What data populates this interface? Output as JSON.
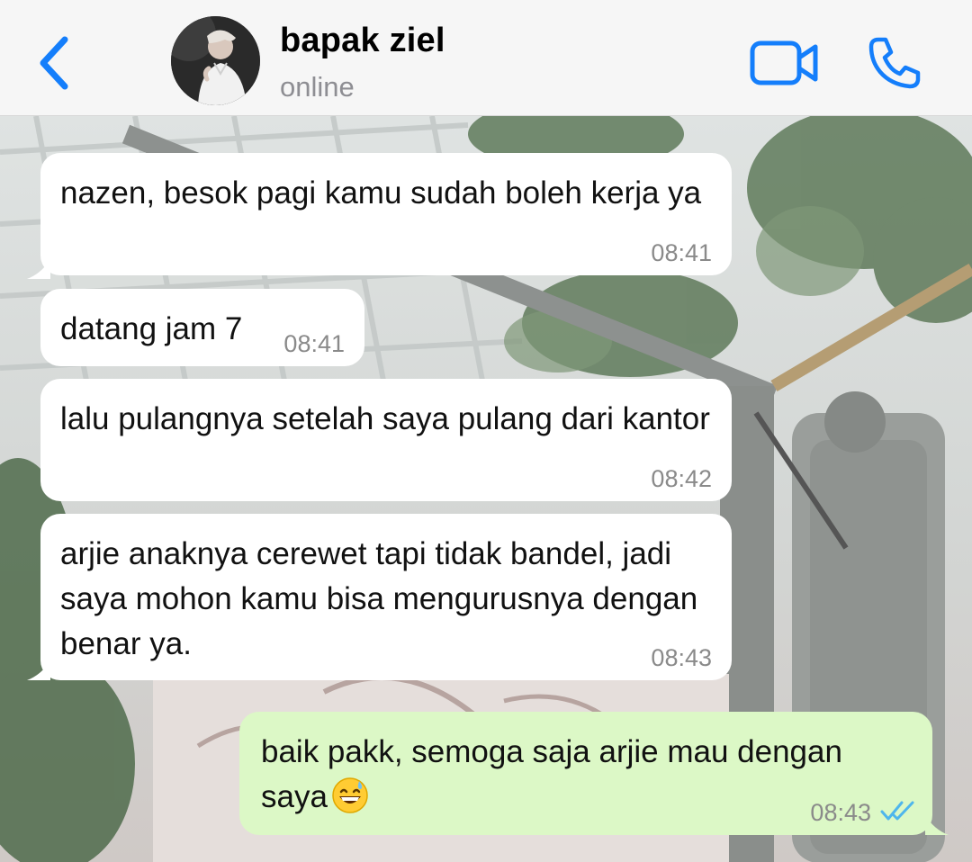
{
  "header": {
    "contact_name": "bapak ziel",
    "contact_status": "online",
    "back_icon": "chevron-left-icon",
    "video_icon": "video-camera-icon",
    "call_icon": "phone-icon",
    "accent_color": "#147efb"
  },
  "messages": [
    {
      "direction": "incoming",
      "text": "nazen, besok pagi kamu sudah boleh kerja ya",
      "time": "08:41"
    },
    {
      "direction": "incoming",
      "text": "datang jam 7",
      "time": "08:41"
    },
    {
      "direction": "incoming",
      "text": "lalu pulangnya setelah saya pulang dari kantor",
      "time": "08:42"
    },
    {
      "direction": "incoming",
      "text": "arjie anaknya cerewet tapi tidak bandel, jadi saya mohon kamu bisa mengurusnya dengan benar ya.",
      "time": "08:43"
    },
    {
      "direction": "outgoing",
      "text": "baik pakk, semoga saja arjie mau dengan saya",
      "emoji": "😅",
      "time": "08:43",
      "status": "read",
      "status_icon": "double-check-icon"
    }
  ],
  "colors": {
    "incoming_bubble": "#ffffff",
    "outgoing_bubble": "#dcf8c6",
    "read_ticks": "#4fb6ec",
    "timestamp": "#8a8a8a"
  }
}
